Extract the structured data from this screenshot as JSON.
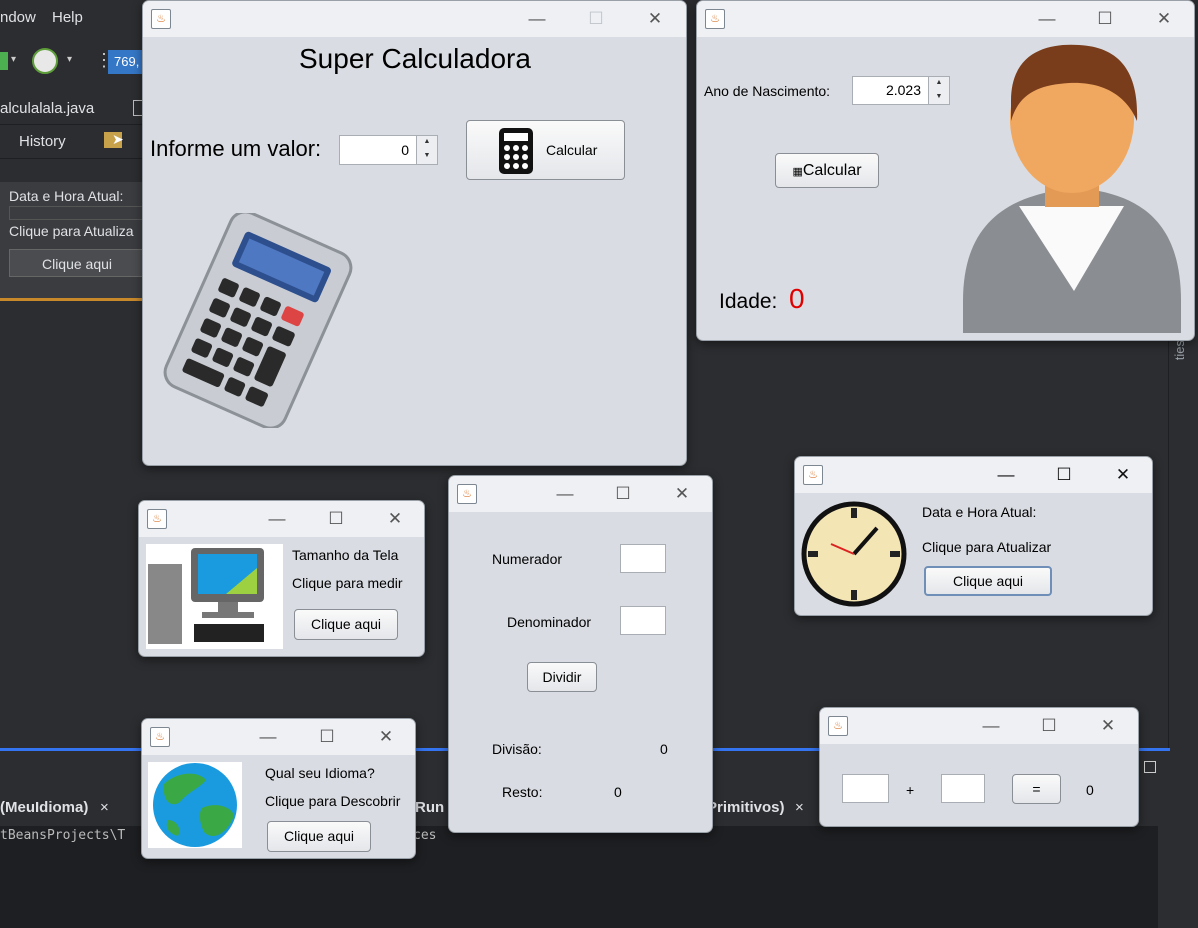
{
  "ide": {
    "menu": [
      "ndow",
      "Help"
    ],
    "toolbar_counter": "769,",
    "editor_tab": "alculalala.java",
    "history_tab": "History",
    "side_panel": {
      "date_label": "Data e Hora Atual:",
      "update_label": "Clique para Atualiza",
      "button": "Clique aqui"
    },
    "output_tabs": [
      "(MeuIdioma)",
      "Run",
      "Primitivos)"
    ],
    "output_close": "×",
    "output_path": "tBeansProjects\\T",
    "output_tail": "ces",
    "side_strip": "ties"
  },
  "super_calc": {
    "title": "Super Calculadora",
    "prompt": "Informe um valor:",
    "value": "0",
    "button": "Calcular",
    "image": "calculator-illustration"
  },
  "age_calc": {
    "label": "Ano de Nascimento:",
    "year": "2.023",
    "button": "Calcular",
    "result_label": "Idade:",
    "result_value": "0",
    "result_color": "#e00000",
    "image": "person-avatar"
  },
  "screen_size": {
    "label": "Tamanho da Tela",
    "prompt": "Clique para medir",
    "button": "Clique aqui",
    "image": "computer-illustration"
  },
  "division": {
    "numerator_label": "Numerador",
    "numerator_value": "",
    "denominator_label": "Denominador",
    "denominator_value": "",
    "button": "Dividir",
    "division_label": "Divisão:",
    "division_value": "0",
    "remainder_label": "Resto:",
    "remainder_value": "0"
  },
  "clock": {
    "label": "Data e Hora Atual:",
    "prompt": "Clique para Atualizar",
    "button": "Clique aqui",
    "image": "clock-illustration"
  },
  "language": {
    "label": "Qual seu Idioma?",
    "prompt": "Clique para Descobrir",
    "button": "Clique aqui",
    "image": "globe-illustration"
  },
  "sum": {
    "first": "",
    "operator": "+",
    "second": "",
    "equals": "=",
    "result": "0"
  },
  "window_controls": {
    "minimize": "—",
    "maximize": "☐",
    "close": "✕"
  }
}
